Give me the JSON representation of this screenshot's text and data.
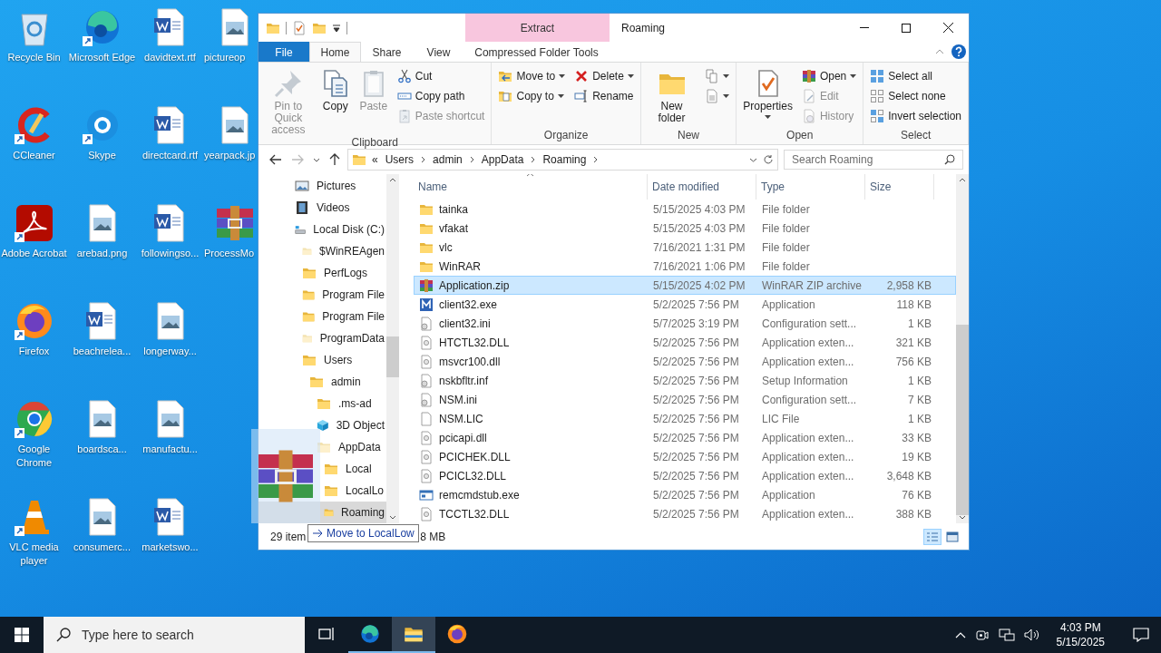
{
  "desktop_icons": [
    {
      "label": "Recycle Bin",
      "kind": "recycle",
      "shortcut": false
    },
    {
      "label": "CCleaner",
      "kind": "ccleaner",
      "shortcut": true
    },
    {
      "label": "Adobe Acrobat",
      "kind": "acrobat",
      "shortcut": true
    },
    {
      "label": "Firefox",
      "kind": "firefox",
      "shortcut": true
    },
    {
      "label": "Google Chrome",
      "kind": "chrome",
      "shortcut": true
    },
    {
      "label": "VLC media player",
      "kind": "vlc",
      "shortcut": true
    },
    {
      "label": "Microsoft Edge",
      "kind": "edge",
      "shortcut": true
    },
    {
      "label": "Skype",
      "kind": "skype",
      "shortcut": true
    },
    {
      "label": "arebad.png",
      "kind": "image",
      "shortcut": false
    },
    {
      "label": "beachrelea...",
      "kind": "word",
      "shortcut": false
    },
    {
      "label": "boardsca...",
      "kind": "image",
      "shortcut": false
    },
    {
      "label": "consumerc...",
      "kind": "image",
      "shortcut": false
    },
    {
      "label": "davidtext.rtf",
      "kind": "word",
      "shortcut": false
    },
    {
      "label": "directcard.rtf",
      "kind": "word",
      "shortcut": false
    },
    {
      "label": "followingso...",
      "kind": "word",
      "shortcut": false
    },
    {
      "label": "longerway...",
      "kind": "image",
      "shortcut": false
    },
    {
      "label": "manufactu...",
      "kind": "image",
      "shortcut": false
    },
    {
      "label": "marketswo...",
      "kind": "word",
      "shortcut": false
    },
    {
      "label": "pictureop",
      "kind": "image",
      "shortcut": false
    },
    {
      "label": "yearpack.jp",
      "kind": "image",
      "shortcut": false
    },
    {
      "label": "ProcessMo",
      "kind": "winrar",
      "shortcut": false
    }
  ],
  "window": {
    "title": "Roaming",
    "context_header": "Extract",
    "tabs": [
      {
        "label": "File",
        "kind": "menu",
        "selected": false
      },
      {
        "label": "Home",
        "kind": "tab",
        "selected": true
      },
      {
        "label": "Share",
        "kind": "tab",
        "selected": false
      },
      {
        "label": "View",
        "kind": "tab",
        "selected": false
      },
      {
        "label": "Compressed Folder Tools",
        "kind": "contextual",
        "selected": false
      }
    ],
    "ribbon": [
      {
        "label": "Clipboard",
        "columns": [
          {
            "kind": "large",
            "items": [
              {
                "label": "Pin to Quick access",
                "kind": "pin",
                "disabled": true,
                "caret": false
              }
            ]
          },
          {
            "kind": "large",
            "items": [
              {
                "label": "Copy",
                "kind": "copy",
                "disabled": false,
                "caret": false
              }
            ]
          },
          {
            "kind": "large",
            "items": [
              {
                "label": "Paste",
                "kind": "paste",
                "disabled": true,
                "caret": false
              }
            ]
          },
          {
            "kind": "stack",
            "items": [
              {
                "label": "Cut",
                "kind": "cut",
                "disabled": false,
                "caret": false
              },
              {
                "label": "Copy path",
                "kind": "copy-path",
                "disabled": false,
                "caret": false
              },
              {
                "label": "Paste shortcut",
                "kind": "paste-shortcut",
                "disabled": true,
                "caret": false
              }
            ]
          }
        ]
      },
      {
        "label": "Organize",
        "columns": [
          {
            "kind": "stack",
            "items": [
              {
                "label": "Move to",
                "kind": "move-to",
                "disabled": false,
                "caret": true
              },
              {
                "label": "Copy to",
                "kind": "copy-to",
                "disabled": false,
                "caret": true
              }
            ]
          },
          {
            "kind": "stack",
            "items": [
              {
                "label": "Delete",
                "kind": "delete",
                "disabled": false,
                "caret": true
              },
              {
                "label": "Rename",
                "kind": "rename",
                "disabled": false,
                "caret": false
              }
            ]
          }
        ]
      },
      {
        "label": "New",
        "columns": [
          {
            "kind": "large",
            "items": [
              {
                "label": "New folder",
                "kind": "new-folder",
                "disabled": false,
                "caret": false
              }
            ]
          },
          {
            "kind": "stack",
            "items": [
              {
                "kind": "new-item",
                "disabled": false,
                "caret": true
              },
              {
                "kind": "easy-access",
                "disabled": false,
                "caret": true
              }
            ]
          }
        ]
      },
      {
        "label": "Open",
        "columns": [
          {
            "kind": "large",
            "items": [
              {
                "label": "Properties",
                "kind": "properties",
                "disabled": false,
                "caret": true
              }
            ]
          },
          {
            "kind": "stack",
            "items": [
              {
                "label": "Open",
                "kind": "open",
                "disabled": false,
                "caret": true
              },
              {
                "label": "Edit",
                "kind": "edit",
                "disabled": true,
                "caret": false
              },
              {
                "label": "History",
                "kind": "history",
                "disabled": true,
                "caret": false
              }
            ]
          }
        ]
      },
      {
        "label": "Select",
        "columns": [
          {
            "kind": "stack",
            "items": [
              {
                "label": "Select all",
                "kind": "select-all",
                "disabled": false,
                "caret": false
              },
              {
                "label": "Select none",
                "kind": "select-none",
                "disabled": false,
                "caret": false
              },
              {
                "label": "Invert selection",
                "kind": "invert",
                "disabled": false,
                "caret": false
              }
            ]
          }
        ]
      }
    ],
    "address": {
      "overflow": "«",
      "path": [
        "Users",
        "admin",
        "AppData",
        "Roaming"
      ]
    },
    "search": {
      "placeholder": "Search Roaming"
    },
    "nav_tree": [
      {
        "label": "Pictures",
        "kind": "pictures",
        "selected": false
      },
      {
        "label": "Videos",
        "kind": "videos",
        "selected": false
      },
      {
        "label": "Local Disk (C:)",
        "kind": "drive",
        "selected": false,
        "children": [
          {
            "label": "$WinREAgen",
            "kind": "hidden-folder",
            "selected": false
          },
          {
            "label": "PerfLogs",
            "kind": "folder",
            "selected": false
          },
          {
            "label": "Program File",
            "kind": "folder",
            "selected": false
          },
          {
            "label": "Program File",
            "kind": "folder",
            "selected": false
          },
          {
            "label": "ProgramData",
            "kind": "hidden-folder",
            "selected": false
          },
          {
            "label": "Users",
            "kind": "folder",
            "selected": false,
            "children": [
              {
                "label": "admin",
                "kind": "folder",
                "selected": false,
                "children": [
                  {
                    "label": ".ms-ad",
                    "kind": "folder",
                    "selected": false
                  },
                  {
                    "label": "3D Object",
                    "kind": "objects",
                    "selected": false
                  },
                  {
                    "label": "AppData",
                    "kind": "hidden-folder",
                    "selected": false,
                    "children": [
                      {
                        "label": "Local",
                        "kind": "folder",
                        "selected": false
                      },
                      {
                        "label": "LocalLo",
                        "kind": "folder",
                        "selected": false
                      },
                      {
                        "label": "Roaming",
                        "kind": "folder",
                        "selected": true
                      }
                    ]
                  }
                ]
              }
            ]
          }
        ]
      }
    ],
    "columns": [
      "Name",
      "Date modified",
      "Type",
      "Size"
    ],
    "files": [
      {
        "name": "tainka",
        "date": "5/15/2025 4:03 PM",
        "type": "File folder",
        "kind": "folder",
        "selected": false
      },
      {
        "name": "vfakat",
        "date": "5/15/2025 4:03 PM",
        "type": "File folder",
        "kind": "folder",
        "selected": false
      },
      {
        "name": "vlc",
        "date": "7/16/2021 1:31 PM",
        "type": "File folder",
        "kind": "folder",
        "selected": false
      },
      {
        "name": "WinRAR",
        "date": "7/16/2021 1:06 PM",
        "type": "File folder",
        "kind": "folder",
        "selected": false
      },
      {
        "name": "Application.zip",
        "date": "5/15/2025 4:02 PM",
        "type": "WinRAR ZIP archive",
        "size": "2,958 KB",
        "kind": "archive",
        "selected": true
      },
      {
        "name": "client32.exe",
        "date": "5/2/2025 7:56 PM",
        "type": "Application",
        "size": "118 KB",
        "kind": "app",
        "selected": false
      },
      {
        "name": "client32.ini",
        "date": "5/7/2025 3:19 PM",
        "type": "Configuration sett...",
        "size": "1 KB",
        "kind": "config",
        "selected": false
      },
      {
        "name": "HTCTL32.DLL",
        "date": "5/2/2025 7:56 PM",
        "type": "Application exten...",
        "size": "321 KB",
        "kind": "dll",
        "selected": false
      },
      {
        "name": "msvcr100.dll",
        "date": "5/2/2025 7:56 PM",
        "type": "Application exten...",
        "size": "756 KB",
        "kind": "dll",
        "selected": false
      },
      {
        "name": "nskbfltr.inf",
        "date": "5/2/2025 7:56 PM",
        "type": "Setup Information",
        "size": "1 KB",
        "kind": "config",
        "selected": false
      },
      {
        "name": "NSM.ini",
        "date": "5/2/2025 7:56 PM",
        "type": "Configuration sett...",
        "size": "7 KB",
        "kind": "config",
        "selected": false
      },
      {
        "name": "NSM.LIC",
        "date": "5/2/2025 7:56 PM",
        "type": "LIC File",
        "size": "1 KB",
        "kind": "blank",
        "selected": false
      },
      {
        "name": "pcicapi.dll",
        "date": "5/2/2025 7:56 PM",
        "type": "Application exten...",
        "size": "33 KB",
        "kind": "dll",
        "selected": false
      },
      {
        "name": "PCICHEK.DLL",
        "date": "5/2/2025 7:56 PM",
        "type": "Application exten...",
        "size": "19 KB",
        "kind": "dll",
        "selected": false
      },
      {
        "name": "PCICL32.DLL",
        "date": "5/2/2025 7:56 PM",
        "type": "Application exten...",
        "size": "3,648 KB",
        "kind": "dll",
        "selected": false
      },
      {
        "name": "remcmdstub.exe",
        "date": "5/2/2025 7:56 PM",
        "type": "Application",
        "size": "76 KB",
        "kind": "window",
        "selected": false
      },
      {
        "name": "TCCTL32.DLL",
        "date": "5/2/2025 7:56 PM",
        "type": "Application exten...",
        "size": "388 KB",
        "kind": "dll",
        "selected": false
      }
    ],
    "status_bar": {
      "item_count": "29 item",
      "selection": "8 MB"
    },
    "views": [
      {
        "kind": "details",
        "selected": true
      },
      {
        "kind": "large-icons",
        "selected": false
      }
    ]
  },
  "drag": {
    "tooltip": "Move to LocalLow"
  },
  "taskbar": {
    "search_placeholder": "Type here to search",
    "apps": [
      {
        "kind": "task-view",
        "running": false,
        "active": false
      },
      {
        "kind": "edge",
        "running": true,
        "active": false
      },
      {
        "kind": "explorer",
        "running": true,
        "active": true
      },
      {
        "kind": "firefox",
        "running": false,
        "active": false
      }
    ],
    "time": "4:03 PM",
    "date": "5/15/2025"
  }
}
